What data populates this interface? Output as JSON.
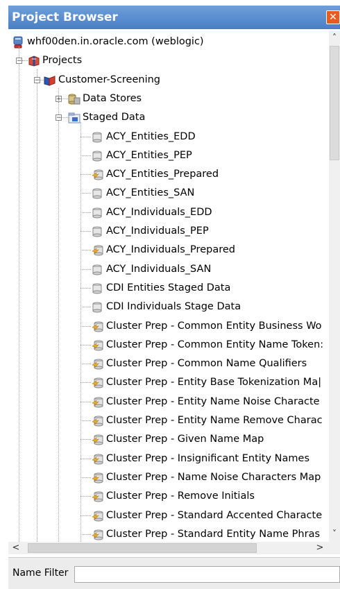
{
  "panel": {
    "title": "Project Browser",
    "close_glyph": "✕"
  },
  "tree": {
    "server": {
      "label": "whf00den.in.oracle.com (weblogic)",
      "icon": "server-icon"
    },
    "projects": {
      "label": "Projects",
      "icon": "projects-icon",
      "expander": "−"
    },
    "project": {
      "label": "Customer-Screening",
      "icon": "project-icon",
      "expander": "−"
    },
    "data_stores": {
      "label": "Data Stores",
      "icon": "database-icon",
      "expander": "+"
    },
    "staged_data": {
      "label": "Staged Data",
      "icon": "staged-data-icon",
      "expander": "−"
    },
    "items": [
      {
        "label": "ACY_Entities_EDD",
        "icon": "data-cylinder-icon"
      },
      {
        "label": "ACY_Entities_PEP",
        "icon": "data-cylinder-icon"
      },
      {
        "label": "ACY_Entities_Prepared",
        "icon": "prepared-data-icon"
      },
      {
        "label": "ACY_Entities_SAN",
        "icon": "data-cylinder-icon"
      },
      {
        "label": "ACY_Individuals_EDD",
        "icon": "data-cylinder-icon"
      },
      {
        "label": "ACY_Individuals_PEP",
        "icon": "data-cylinder-icon"
      },
      {
        "label": "ACY_Individuals_Prepared",
        "icon": "prepared-data-icon"
      },
      {
        "label": "ACY_Individuals_SAN",
        "icon": "data-cylinder-icon"
      },
      {
        "label": "CDI Entities Staged  Data",
        "icon": "data-cylinder-icon"
      },
      {
        "label": "CDI Individuals Stage Data",
        "icon": "data-cylinder-icon"
      },
      {
        "label": "Cluster Prep - Common Entity Business Wo",
        "icon": "prepared-data-icon"
      },
      {
        "label": "Cluster Prep - Common Entity Name Token:",
        "icon": "prepared-data-icon"
      },
      {
        "label": "Cluster Prep - Common Name Qualifiers",
        "icon": "prepared-data-icon"
      },
      {
        "label": "Cluster Prep - Entity Base Tokenization Ma|",
        "icon": "prepared-data-icon"
      },
      {
        "label": "Cluster Prep - Entity Name Noise Characte",
        "icon": "prepared-data-icon"
      },
      {
        "label": "Cluster Prep - Entity Name Remove Charac",
        "icon": "prepared-data-icon"
      },
      {
        "label": "Cluster Prep - Given Name Map",
        "icon": "prepared-data-icon"
      },
      {
        "label": "Cluster Prep - Insignificant Entity Names",
        "icon": "prepared-data-icon"
      },
      {
        "label": "Cluster Prep - Name Noise Characters Map",
        "icon": "prepared-data-icon"
      },
      {
        "label": "Cluster Prep - Remove Initials",
        "icon": "prepared-data-icon"
      },
      {
        "label": "Cluster Prep - Standard Accented Characte",
        "icon": "prepared-data-icon"
      },
      {
        "label": "Cluster Prep - Standard Entity Name Phras",
        "icon": "prepared-data-icon"
      }
    ]
  },
  "scroll": {
    "up": "˄",
    "down": "˅",
    "left": "<",
    "right": ">"
  },
  "filter": {
    "label": "Name Filter",
    "value": "",
    "placeholder": ""
  },
  "colors": {
    "title_bar": "#4a7fc6",
    "close_button": "#e95a1e",
    "prepared_icon": "#f0b429"
  }
}
